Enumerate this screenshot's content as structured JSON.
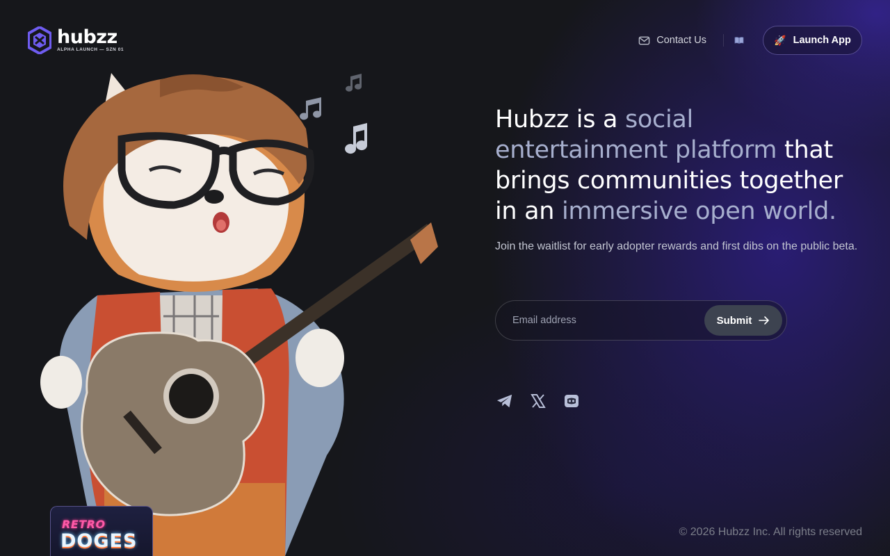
{
  "brand": {
    "name": "hubzz",
    "tagline": "ALPHA LAUNCH — SZN 01"
  },
  "nav": {
    "contact_label": "Contact Us",
    "launch_label": "Launch App"
  },
  "hero": {
    "headline_1": "Hubzz is a ",
    "headline_accent_1": "social entertainment platform",
    "headline_2": " that brings communities together in an ",
    "headline_accent_2": "immersive open world.",
    "subtitle": "Join the waitlist for early adopter rewards and first dibs on the public beta."
  },
  "form": {
    "email_placeholder": "Email address",
    "submit_label": "Submit"
  },
  "socials": [
    "telegram-icon",
    "x-icon",
    "discord-icon"
  ],
  "badge": {
    "line1": "RETRO",
    "line2": "DOGES"
  },
  "footer": {
    "copyright": "© 2026 Hubzz Inc. All rights reserved"
  },
  "colors": {
    "background": "#16171b",
    "accent_text": "#a7afce",
    "brand_purple": "#6f5cf0",
    "submit_bg": "#3d4350"
  }
}
